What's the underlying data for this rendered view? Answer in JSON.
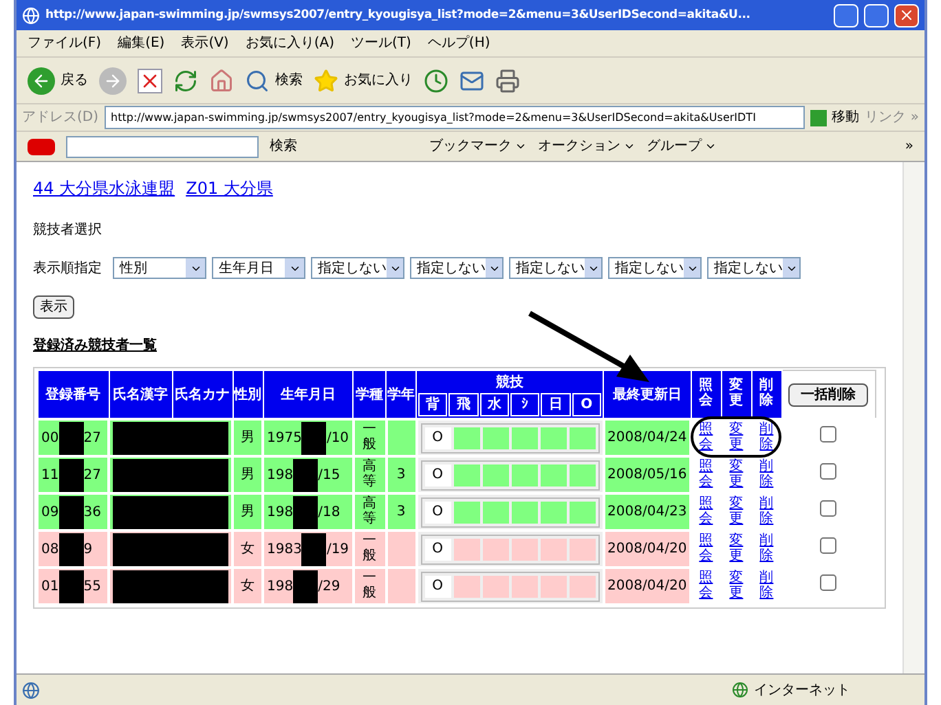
{
  "window": {
    "title": "http://www.japan-swimming.jp/swmsys2007/entry_kyougisya_list?mode=2&menu=3&UserIDSecond=akita&U..."
  },
  "menu": [
    "ファイル(F)",
    "編集(E)",
    "表示(V)",
    "お気に入り(A)",
    "ツール(T)",
    "ヘルプ(H)"
  ],
  "toolbar": {
    "back": "戻る",
    "search": "検索",
    "favorites": "お気に入り"
  },
  "address": {
    "label": "アドレス(D)",
    "url": "http://www.japan-swimming.jp/swmsys2007/entry_kyougisya_list?mode=2&menu=3&UserIDSecond=akita&UserIDTI",
    "go": "移動",
    "links": "リンク »"
  },
  "yahoo_bar": {
    "search": "検索",
    "items": [
      "ブックマーク",
      "オークション",
      "グループ"
    ],
    "more": "»"
  },
  "page": {
    "breadcrumb": [
      "44 大分県水泳連盟",
      "Z01 大分県"
    ],
    "section": "競技者選択",
    "sort_label": "表示順指定",
    "sort_selects": [
      "性別",
      "生年月日",
      "指定しない",
      "指定しない",
      "指定しない",
      "指定しない",
      "指定しない"
    ],
    "show_button": "表示",
    "list_title": "登録済み競技者一覧"
  },
  "table": {
    "columns": [
      "登録番号",
      "氏名漢字",
      "氏名カナ",
      "性別",
      "生年月日",
      "学種",
      "学年"
    ],
    "event_header": "競技",
    "event_columns": [
      "背",
      "飛",
      "水",
      "ｼ",
      "日",
      "O"
    ],
    "updated_header": "最終更新日",
    "action_headers": [
      "照会",
      "変更",
      "削除"
    ],
    "bulk_delete_button": "一括削除",
    "rows": [
      {
        "color": "#80ff80",
        "reg_start": "00",
        "reg_end": "27",
        "name_redacted": true,
        "gender": "男",
        "birth_start": "1975",
        "birth_end": "/10",
        "school_type": "一般",
        "events": [
          {
            "entered": true,
            "mark": "O"
          },
          {
            "entered": false
          },
          {
            "entered": false
          },
          {
            "entered": false
          },
          {
            "entered": false
          },
          {
            "entered": false
          }
        ],
        "updated": "2008/04/24",
        "actions": [
          "照会",
          "変更",
          "削除"
        ],
        "checked": false
      },
      {
        "color": "#80ff80",
        "reg_start": "11",
        "reg_end": "27",
        "name_redacted": true,
        "gender": "男",
        "birth_start": "198",
        "birth_end": "/15",
        "school_type": "高等",
        "grade": "3",
        "events": [
          {
            "entered": true,
            "mark": "O"
          },
          {
            "entered": false
          },
          {
            "entered": false
          },
          {
            "entered": false
          },
          {
            "entered": false
          },
          {
            "entered": false
          }
        ],
        "updated": "2008/05/16",
        "actions": [
          "照会",
          "変更",
          "削除"
        ],
        "checked": false
      },
      {
        "color": "#80ff80",
        "reg_start": "09",
        "reg_end": "36",
        "name_redacted": true,
        "gender": "男",
        "birth_start": "198",
        "birth_end": "/18",
        "school_type": "高等",
        "grade": "3",
        "events": [
          {
            "entered": true,
            "mark": "O"
          },
          {
            "entered": false
          },
          {
            "entered": false
          },
          {
            "entered": false
          },
          {
            "entered": false
          },
          {
            "entered": false
          }
        ],
        "updated": "2008/04/23",
        "actions": [
          "照会",
          "変更",
          "削除"
        ],
        "checked": false
      },
      {
        "color": "#ffcccc",
        "reg_start": "08",
        "reg_end": "9",
        "name_redacted": true,
        "gender": "女",
        "birth_start": "1983",
        "birth_end": "/19",
        "school_type": "一般",
        "events": [
          {
            "entered": true,
            "mark": "O"
          },
          {
            "entered": false
          },
          {
            "entered": false
          },
          {
            "entered": false
          },
          {
            "entered": false
          },
          {
            "entered": false
          }
        ],
        "updated": "2008/04/20",
        "actions": [
          "照会",
          "変更",
          "削除"
        ],
        "checked": false
      },
      {
        "color": "#ffcccc",
        "reg_start": "01",
        "reg_end": "55",
        "name_redacted": true,
        "gender": "女",
        "birth_start": "198",
        "birth_end": "/29",
        "school_type": "一般",
        "events": [
          {
            "entered": true,
            "mark": "O"
          },
          {
            "entered": false
          },
          {
            "entered": false
          },
          {
            "entered": false
          },
          {
            "entered": false
          },
          {
            "entered": false
          }
        ],
        "updated": "2008/04/20",
        "actions": [
          "照会",
          "変更",
          "削除"
        ],
        "checked": false
      }
    ]
  },
  "status_bar": {
    "zone": "インターネット"
  }
}
